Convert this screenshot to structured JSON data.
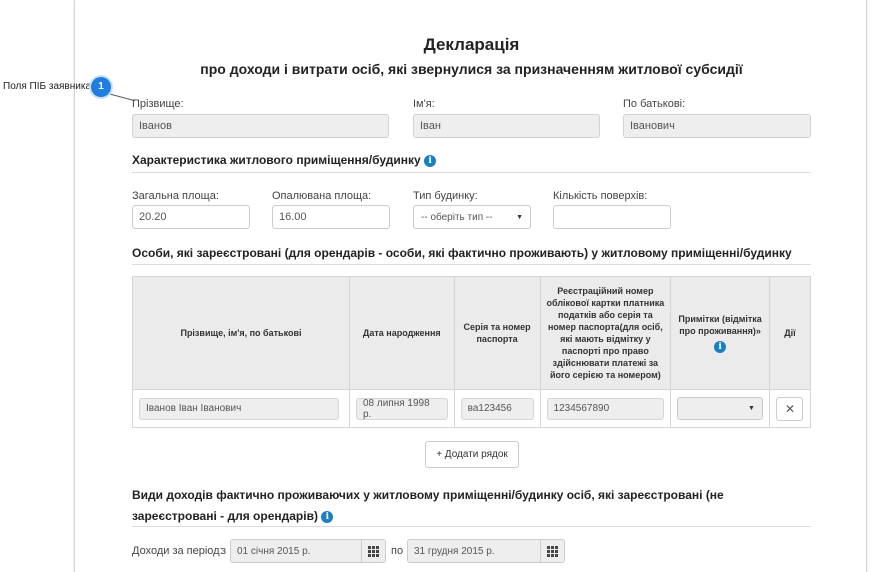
{
  "callout": {
    "label": "Поля ПІБ заявника",
    "number": "1"
  },
  "header": {
    "title": "Декларація",
    "subtitle": "про доходи і витрати осіб, які звернулися за призначенням житлової субсидії"
  },
  "applicant": {
    "surname_label": "Прізвище:",
    "surname_value": "Іванов",
    "name_label": "Ім'я:",
    "name_value": "Іван",
    "patronymic_label": "По батькові:",
    "patronymic_value": "Іванович"
  },
  "dwelling": {
    "section_title": "Характеристика житлового приміщення/будинку",
    "total_area_label": "Загальна площа:",
    "total_area_value": "20.20",
    "heated_area_label": "Опалювана площа:",
    "heated_area_value": "16.00",
    "house_type_label": "Тип будинку:",
    "house_type_value": "-- оберіть тип --",
    "floors_label": "Кількість поверхів:",
    "floors_value": ""
  },
  "persons": {
    "section_title": "Особи, які зареєстровані (для орендарів - особи, які фактично проживають) у житловому приміщенні/будинку",
    "columns": [
      "Прізвище, ім'я, по батькові",
      "Дата народження",
      "Серія та номер паспорта",
      "Реєстраційний номер облікової картки платника податків або серія та номер паспорта(для осіб, які мають відмітку у паспорті про право здійснювати платежі за його серією та номером)",
      "Примітки (відмітка про проживання)»",
      "Дії"
    ],
    "rows": [
      {
        "full_name": "Іванов Іван Іванович",
        "birth_date": "08 липня 1998 р.",
        "passport": "ва123456",
        "tax_number": "1234567890",
        "note": ""
      }
    ],
    "delete_symbol": "✕",
    "add_row_label": "+ Додати рядок"
  },
  "income": {
    "section_title": "Види доходів фактично проживаючих у житловому приміщенні/будинку осіб, які зареєстровані (не зареєстровані - для орендарів)",
    "period_label": "Доходи за період:",
    "from_label": "з",
    "from_value": "01 січня 2015 р.",
    "to_label": "по",
    "to_value": "31 грудня 2015 р."
  },
  "colors": {
    "accent": "#1f7de0",
    "info": "#1a7fc1"
  }
}
